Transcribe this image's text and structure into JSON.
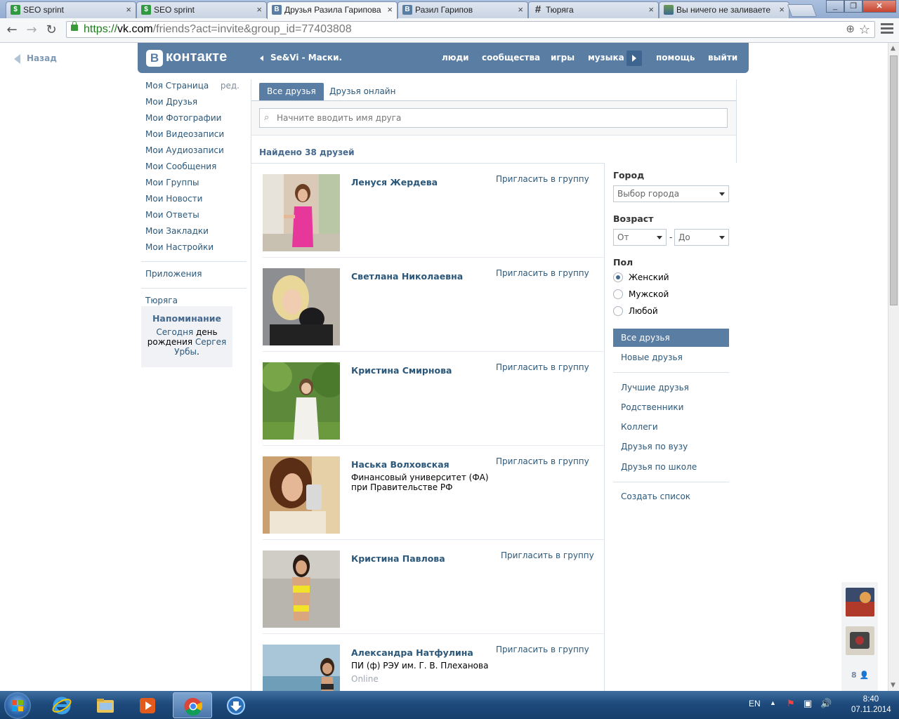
{
  "browser": {
    "tabs": [
      {
        "title": "SEO sprint",
        "icon": "seosprint-icon",
        "active": false
      },
      {
        "title": "SEO sprint",
        "icon": "seosprint-icon",
        "active": false
      },
      {
        "title": "Друзья Разила Гарипова",
        "icon": "vk-icon",
        "active": true
      },
      {
        "title": "Разил Гарипов",
        "icon": "vk-icon",
        "active": false
      },
      {
        "title": "Тюряга",
        "icon": "hash-icon",
        "active": false
      },
      {
        "title": "Вы ничего не заливаете",
        "icon": "image-icon",
        "active": false
      }
    ],
    "url": {
      "scheme": "https://",
      "host": "vk.com",
      "path": "/friends?act=invite&group_id=77403808"
    }
  },
  "page": {
    "back_label": "Назад",
    "logo_text": "контакте",
    "logo_letter": "В",
    "player_text": "Se&Vi - Маски.",
    "top_nav": [
      "люди",
      "сообщества",
      "игры",
      "музыка",
      "помощь",
      "выйти"
    ],
    "left_menu": {
      "items": [
        "Моя Страница",
        "Мои Друзья",
        "Мои Фотографии",
        "Мои Видеозаписи",
        "Мои Аудиозаписи",
        "Мои Сообщения",
        "Мои Группы",
        "Мои Новости",
        "Мои Ответы",
        "Мои Закладки",
        "Мои Настройки"
      ],
      "edit_label": "ред.",
      "apps": "Приложения",
      "extra": "Тюряга"
    },
    "reminder": {
      "title": "Напоминание",
      "t1": "Сегодня",
      "t2": " день рождения ",
      "t3": "Сергея Урбы",
      "t4": "."
    },
    "tabs": [
      "Все друзья",
      "Друзья онлайн"
    ],
    "search_placeholder": "Начните вводить имя друга",
    "found_text": "Найдено 38 друзей",
    "invite_label": "Пригласить в группу",
    "friends": [
      {
        "name": "Ленуся Жердева",
        "sub": "",
        "status": ""
      },
      {
        "name": "Светлана Николаевна",
        "sub": "",
        "status": ""
      },
      {
        "name": "Кристина Смирнова",
        "sub": "",
        "status": ""
      },
      {
        "name": "Наська Волховская",
        "sub": "Финансовый университет (ФА) при Правительстве РФ",
        "status": ""
      },
      {
        "name": "Кристина Павлова",
        "sub": "",
        "status": ""
      },
      {
        "name": "Александра Натфулина",
        "sub": "ПИ (ф) РЭУ им. Г. В. Плеханова",
        "status": "Online"
      }
    ],
    "filters": {
      "city_label": "Город",
      "city_value": "Выбор города",
      "age_label": "Возраст",
      "age_from": "От",
      "age_dash": "-",
      "age_to": "До",
      "sex_label": "Пол",
      "sex_options": [
        "Женский",
        "Мужской",
        "Любой"
      ],
      "sex_selected": "Женский",
      "lists": [
        "Все друзья",
        "Новые друзья"
      ],
      "lists2": [
        "Лучшие друзья",
        "Родственники",
        "Коллеги",
        "Друзья по вузу",
        "Друзья по школе"
      ],
      "create_list": "Создать список"
    },
    "side_count": "8"
  },
  "taskbar": {
    "lang": "EN",
    "time": "8:40",
    "date": "07.11.2014"
  },
  "colors": {
    "vk_blue": "#597da3",
    "link": "#2b587a",
    "header_dark": "#45688e"
  }
}
